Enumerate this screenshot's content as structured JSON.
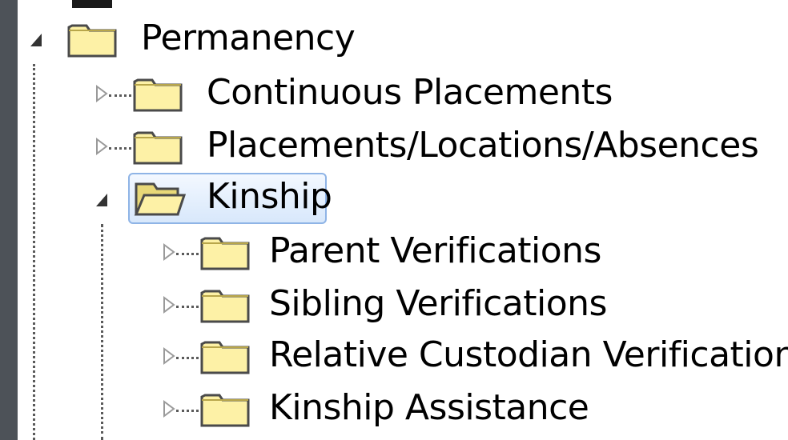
{
  "tree": {
    "items": [
      {
        "label": "Permanency",
        "expanded": true,
        "level": 0
      },
      {
        "label": "Continuous Placements",
        "expanded": false,
        "level": 1
      },
      {
        "label": "Placements/Locations/Absences",
        "expanded": false,
        "level": 1
      },
      {
        "label": "Kinship",
        "expanded": true,
        "selected": true,
        "level": 1
      },
      {
        "label": "Parent Verifications",
        "expanded": false,
        "level": 2
      },
      {
        "label": "Sibling Verifications",
        "expanded": false,
        "level": 2
      },
      {
        "label": "Relative Custodian Verifications",
        "expanded": false,
        "level": 2
      },
      {
        "label": "Kinship Assistance",
        "expanded": false,
        "level": 2
      }
    ]
  },
  "colors": {
    "frame": "#4d5258",
    "folder_fill": "#fdf1a6",
    "folder_stroke": "#4a4a4a",
    "selection_border": "#8fb4e6"
  }
}
